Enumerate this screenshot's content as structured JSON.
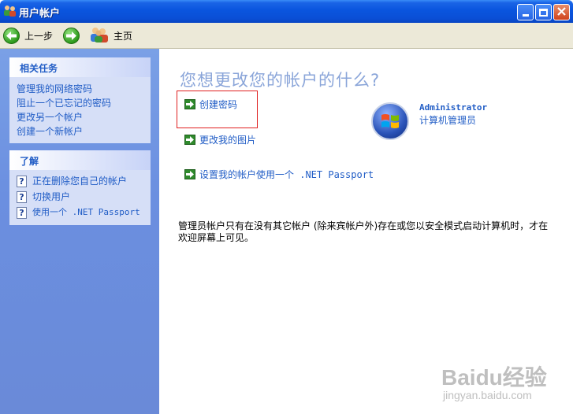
{
  "window": {
    "title": "用户帐户",
    "icon": "users-icon",
    "controls": [
      "minimize-icon",
      "maximize-icon",
      "close-icon"
    ]
  },
  "toolbar": {
    "back_label": "上一步",
    "home_label": "主页"
  },
  "sidebar": {
    "related_tasks": {
      "title": "相关任务",
      "items": [
        "管理我的网络密码",
        "阻止一个已忘记的密码",
        "更改另一个帐户",
        "创建一个新帐户"
      ]
    },
    "learn": {
      "title": "了解",
      "items": [
        "正在删除您自己的帐户",
        "切换用户",
        "使用一个 .NET Passport"
      ]
    }
  },
  "main": {
    "question": "您想更改您的帐户的什么?",
    "actions": [
      "创建密码",
      "更改我的图片",
      "设置我的帐户使用一个 .NET Passport"
    ],
    "account": {
      "name": "Administrator",
      "role": "计算机管理员"
    },
    "note": "管理员帐户只有在没有其它帐户 (除来宾帐户外)存在或您以安全模式启动计算机时，才在欢迎屏幕上可见。"
  },
  "watermark": {
    "brand": "Baidu经验",
    "url": "jingyan.baidu.com"
  },
  "colors": {
    "titlebar": "#0a55de",
    "link": "#215dc6",
    "highlight": "#e02020"
  }
}
